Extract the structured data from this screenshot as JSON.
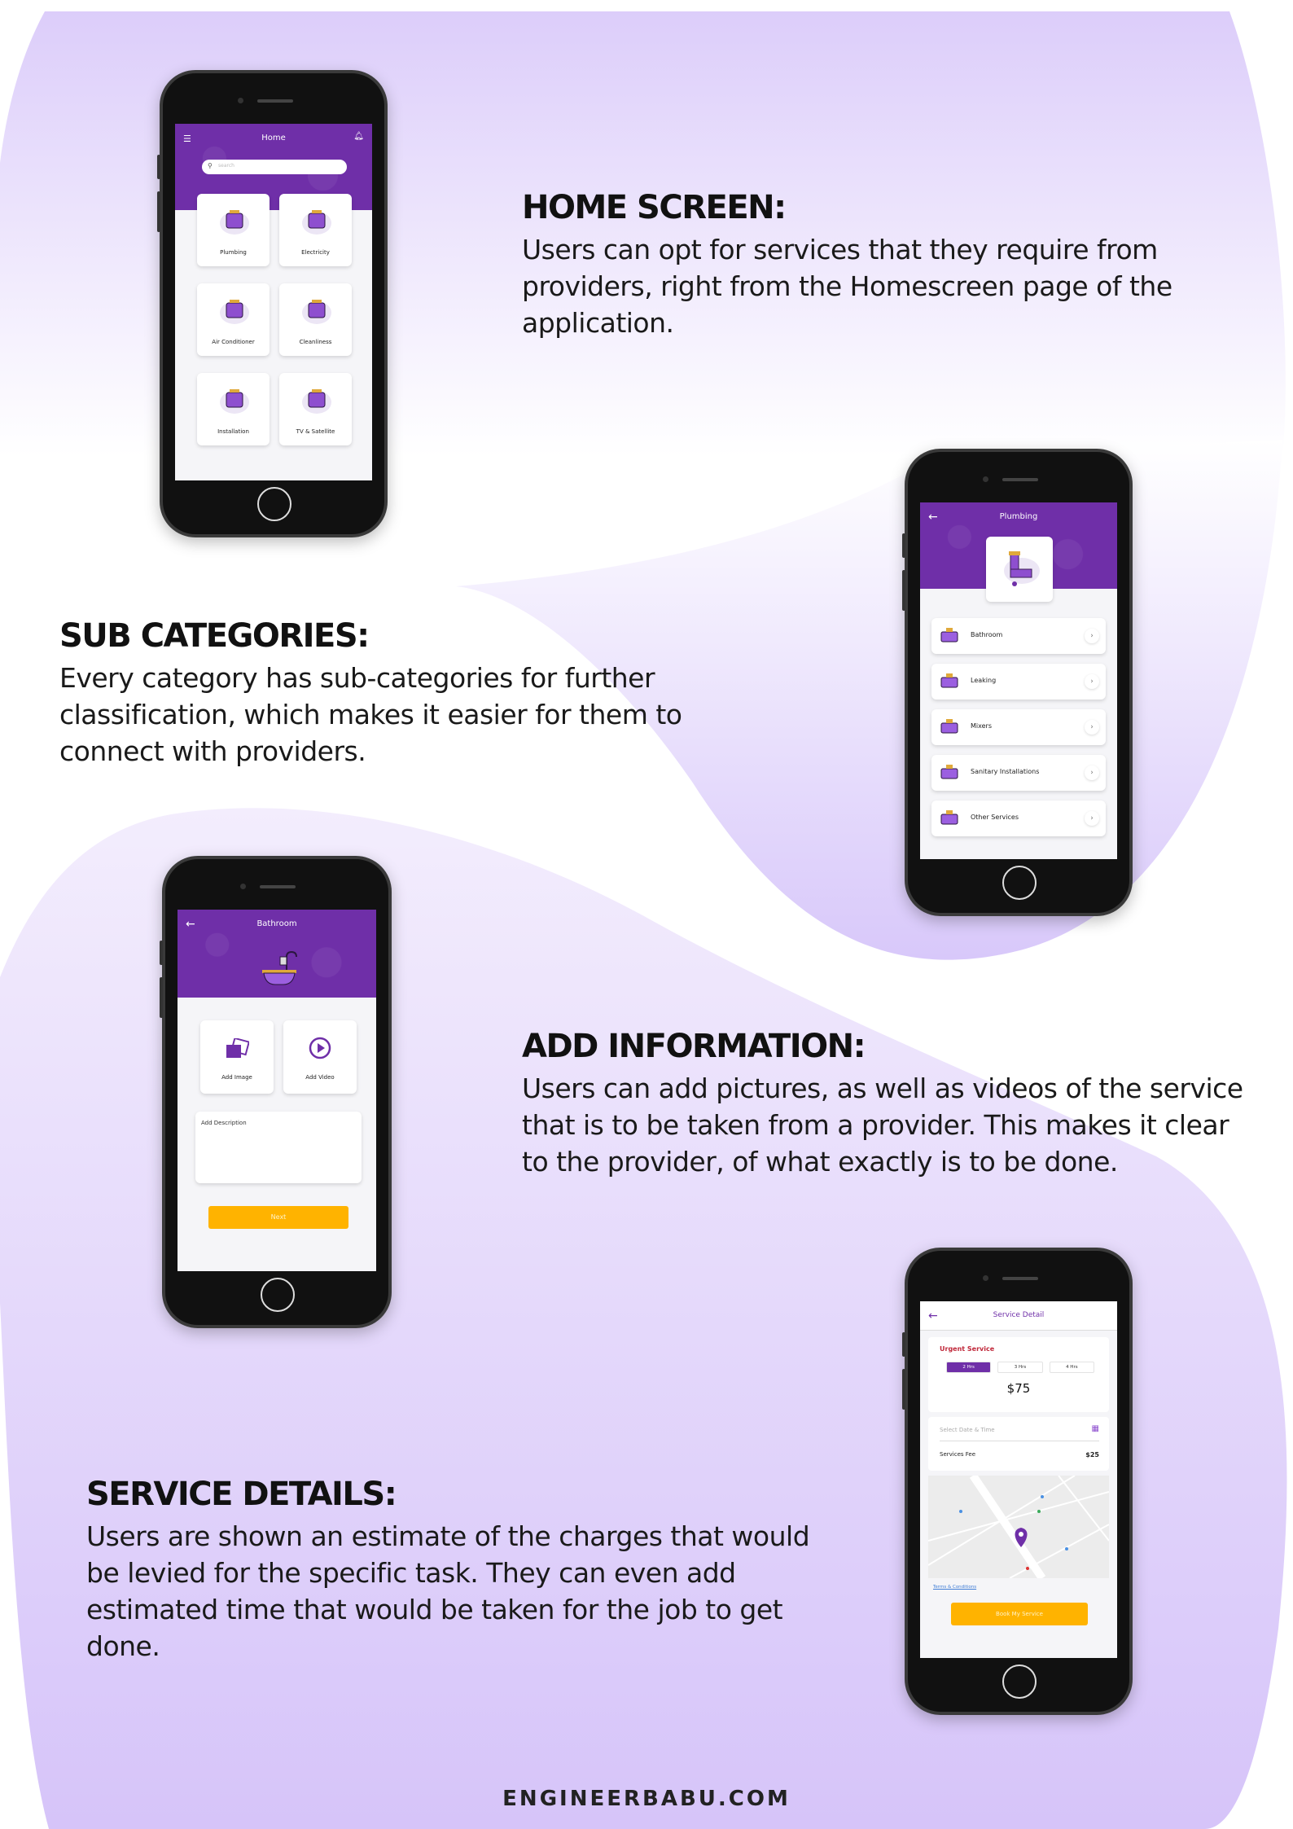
{
  "sections": [
    {
      "title": "HOME SCREEN:",
      "body": "Users can opt for services that they require from providers, right from the Homescreen page of the application."
    },
    {
      "title": "SUB CATEGORIES:",
      "body": "Every category has sub-categories for further classification, which makes it easier for them to connect with providers."
    },
    {
      "title": "ADD INFORMATION:",
      "body": "Users can add pictures, as well as videos of the service that is to be taken from a provider. This makes it clear to the provider, of what exactly is to be done."
    },
    {
      "title": "SERVICE DETAILS:",
      "body": "Users are shown an estimate of the charges that would be levied for the specific task. They can even add estimated time that would be taken for the job to get done."
    }
  ],
  "footer": "ENGINEERBABU.COM",
  "colors": {
    "brand_purple": "#6f2fa8",
    "accent_orange": "#ffb300",
    "urgent_red": "#c0283a",
    "background_lavender": "#ddd0fa"
  },
  "home": {
    "title": "Home",
    "search_placeholder": "search",
    "categories": [
      "Plumbing",
      "Electricity",
      "Air Conditioner",
      "Cleanliness",
      "Installation",
      "TV & Satellite"
    ]
  },
  "plumbing": {
    "title": "Plumbing",
    "items": [
      "Bathroom",
      "Leaking",
      "Mixers",
      "Sanitary Installations",
      "Other Services"
    ]
  },
  "bathroom": {
    "title": "Bathroom",
    "add_image": "Add Image",
    "add_video": "Add Video",
    "description_placeholder": "Add Description",
    "next": "Next"
  },
  "service": {
    "title": "Service Detail",
    "urgent": "Urgent Service",
    "durations": [
      "2 Hrs",
      "3 Hrs",
      "4 Hrs"
    ],
    "selected_duration": "2 Hrs",
    "price": "$75",
    "date_placeholder": "Select Date & Time",
    "fee_label": "Services Fee",
    "fee_value": "$25",
    "terms": "Terms & Conditions",
    "book": "Book My Service"
  }
}
